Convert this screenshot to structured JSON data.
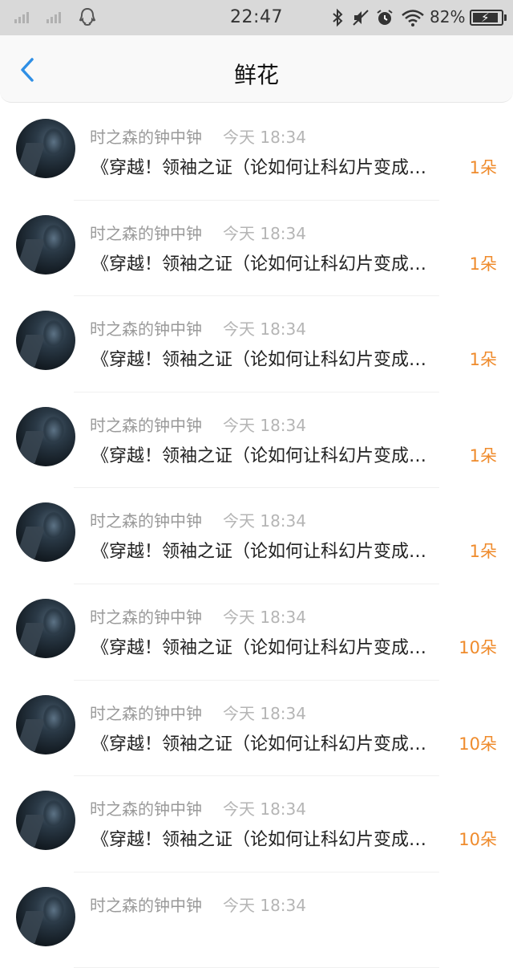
{
  "status_bar": {
    "time": "22:47",
    "battery": "82%",
    "icons": [
      "signal-icon",
      "signal-icon",
      "qq-icon",
      "bluetooth-icon",
      "mute-icon",
      "alarm-icon",
      "wifi-icon",
      "battery-icon"
    ]
  },
  "nav": {
    "title": "鲜花",
    "back_icon": "chevron-left-icon"
  },
  "colors": {
    "accent_blue": "#2f8fe5",
    "count_orange": "#ef8b2c"
  },
  "rows": [
    {
      "name": "时之森的钟中钟",
      "time": "今天 18:34",
      "message": "《穿越！领袖之证（论如何让科幻片变成…",
      "count": "1朵"
    },
    {
      "name": "时之森的钟中钟",
      "time": "今天 18:34",
      "message": "《穿越！领袖之证（论如何让科幻片变成…",
      "count": "1朵"
    },
    {
      "name": "时之森的钟中钟",
      "time": "今天 18:34",
      "message": "《穿越！领袖之证（论如何让科幻片变成…",
      "count": "1朵"
    },
    {
      "name": "时之森的钟中钟",
      "time": "今天 18:34",
      "message": "《穿越！领袖之证（论如何让科幻片变成…",
      "count": "1朵"
    },
    {
      "name": "时之森的钟中钟",
      "time": "今天 18:34",
      "message": "《穿越！领袖之证（论如何让科幻片变成…",
      "count": "1朵"
    },
    {
      "name": "时之森的钟中钟",
      "time": "今天 18:34",
      "message": "《穿越！领袖之证（论如何让科幻片变成…",
      "count": "10朵"
    },
    {
      "name": "时之森的钟中钟",
      "time": "今天 18:34",
      "message": "《穿越！领袖之证（论如何让科幻片变成…",
      "count": "10朵"
    },
    {
      "name": "时之森的钟中钟",
      "time": "今天 18:34",
      "message": "《穿越！领袖之证（论如何让科幻片变成…",
      "count": "10朵"
    },
    {
      "name": "时之森的钟中钟",
      "time": "今天 18:34",
      "message": "",
      "count": ""
    }
  ]
}
